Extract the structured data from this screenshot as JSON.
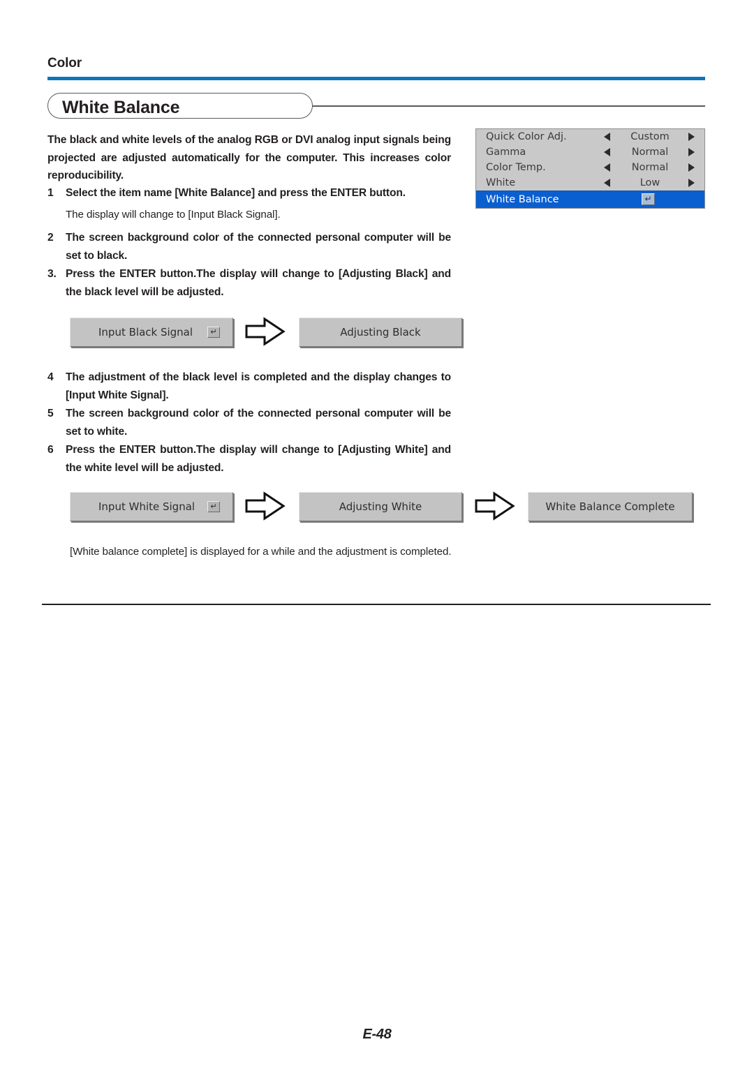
{
  "header": {
    "section_label": "Color",
    "title": "White Balance",
    "accent_color": "#0b75bc"
  },
  "intro": "The black and white levels of the analog RGB or DVI analog input signals being projected are adjusted automatically for the computer. This increases color reproducibility.",
  "steps": [
    {
      "num": "1",
      "text": "Select the item name [White Balance] and press the ENTER button."
    },
    {
      "num": "2",
      "text": "The screen background color of the connected personal computer will be set to black."
    },
    {
      "num": "3.",
      "text": "Press the ENTER button.The display will change to [Adjusting Black] and the black level will be adjusted."
    },
    {
      "num": "4",
      "text": "The adjustment of the black level is completed and the display changes to [Input White Signal]."
    },
    {
      "num": "5",
      "text": "The screen background color of the connected personal computer will be set to white."
    },
    {
      "num": "6",
      "text": "Press the ENTER button.The display will change to [Adjusting White] and the white level will be adjusted."
    }
  ],
  "notes": {
    "after_step1": "The display will change to [Input Black Signal].",
    "closing": "[White balance complete] is displayed for a while and the adjustment is completed."
  },
  "osd_menu": {
    "rows": [
      {
        "label": "Quick Color Adj.",
        "value": "Custom",
        "selected": false
      },
      {
        "label": "Gamma",
        "value": "Normal",
        "selected": false
      },
      {
        "label": "Color Temp.",
        "value": "Normal",
        "selected": false
      },
      {
        "label": "White",
        "value": "Low",
        "selected": false
      }
    ],
    "selected_row": {
      "label": "White Balance",
      "enter_glyph": "↵"
    },
    "highlight_color": "#0a5fd0",
    "panel_color": "#c9c9c9",
    "arrow_left_glyph": "◀",
    "arrow_right_glyph": "▶"
  },
  "flow_black": {
    "box1": {
      "label": "Input Black Signal",
      "enter_glyph": "↵"
    },
    "box2": {
      "label": "Adjusting Black"
    }
  },
  "flow_white": {
    "box1": {
      "label": "Input White Signal",
      "enter_glyph": "↵"
    },
    "box2": {
      "label": "Adjusting White"
    },
    "box3": {
      "label": "White Balance Complete"
    }
  },
  "footer": {
    "page_number": "E-48"
  }
}
